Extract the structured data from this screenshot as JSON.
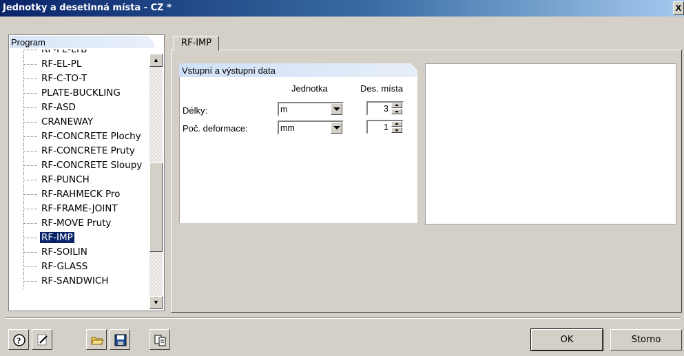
{
  "window": {
    "title": "Jednotky a desetinná místa - CZ *",
    "close_label": "X"
  },
  "tree": {
    "header": "Program",
    "items": [
      "RF-FE-LTB",
      "RF-EL-PL",
      "RF-C-TO-T",
      "PLATE-BUCKLING",
      "RF-ASD",
      "CRANEWAY",
      "RF-CONCRETE Plochy",
      "RF-CONCRETE Pruty",
      "RF-CONCRETE Sloupy",
      "RF-PUNCH",
      "RF-RAHMECK Pro",
      "RF-FRAME-JOINT",
      "RF-MOVE Pruty",
      "RF-IMP",
      "RF-SOILIN",
      "RF-GLASS",
      "RF-SANDWICH"
    ],
    "selected": "RF-IMP"
  },
  "tab": {
    "label": "RF-IMP"
  },
  "group": {
    "title": "Vstupní a výstupní data",
    "col_unit": "Jednotka",
    "col_decimals": "Des. místa",
    "rows": [
      {
        "label": "Délky:",
        "unit": "m",
        "decimals": "3"
      },
      {
        "label": "Poč. deformace:",
        "unit": "mm",
        "decimals": "1"
      }
    ]
  },
  "footer": {
    "ok": "OK",
    "cancel": "Storno"
  },
  "icons": [
    "help-icon",
    "edit-icon",
    "open-folder-icon",
    "save-icon",
    "copy-icon"
  ]
}
